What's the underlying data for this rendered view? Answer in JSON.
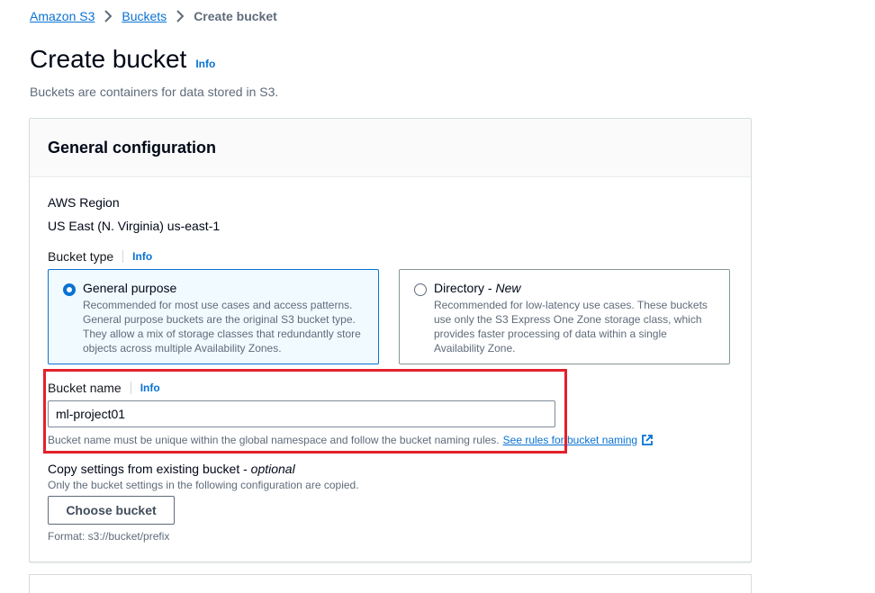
{
  "breadcrumb": {
    "items": [
      "Amazon S3",
      "Buckets"
    ],
    "current": "Create bucket"
  },
  "page": {
    "title": "Create bucket",
    "info": "Info",
    "description": "Buckets are containers for data stored in S3."
  },
  "general_config": {
    "heading": "General configuration",
    "region_label": "AWS Region",
    "region_value": "US East (N. Virginia) us-east-1",
    "bucket_type_label": "Bucket type",
    "bucket_type_info": "Info",
    "options": [
      {
        "title": "General purpose",
        "tag": "",
        "selected": true,
        "description": "Recommended for most use cases and access patterns. General purpose buckets are the original S3 bucket type. They allow a mix of storage classes that redundantly store objects across multiple Availability Zones."
      },
      {
        "title": "Directory - ",
        "tag": "New",
        "selected": false,
        "description": "Recommended for low-latency use cases. These buckets use only the S3 Express One Zone storage class, which provides faster processing of data within a single Availability Zone."
      }
    ],
    "bucket_name_label": "Bucket name",
    "bucket_name_info": "Info",
    "bucket_name_value": "ml-project01",
    "bucket_name_constraint": "Bucket name must be unique within the global namespace and follow the bucket naming rules.",
    "bucket_name_rules_link": "See rules for bucket naming",
    "copy_label": "Copy settings from existing bucket - ",
    "copy_optional": "optional",
    "copy_description": "Only the bucket settings in the following configuration are copied.",
    "choose_button": "Choose bucket",
    "format_hint": "Format: s3://bucket/prefix"
  },
  "colors": {
    "link": "#0972d3",
    "highlight": "#e2212b",
    "selected_tile_bg": "#f1faff"
  }
}
